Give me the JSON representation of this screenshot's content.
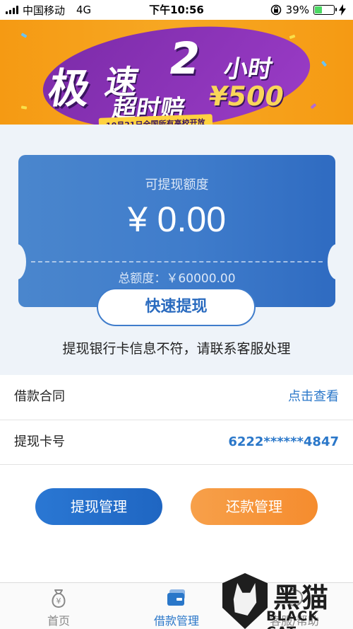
{
  "status_bar": {
    "carrier": "中国移动",
    "network": "4G",
    "time": "下午10:56",
    "battery_text": "39%",
    "battery_level": 0.39
  },
  "banner": {
    "word1": "极",
    "word2": "速",
    "number": "2",
    "unit": "小时",
    "overtime": "超时赔",
    "amount": "¥500",
    "tagline": "10月21日全国所有高校开放"
  },
  "card": {
    "available_label": "可提现额度",
    "available_value": "¥ 0.00",
    "total_text": "总额度：￥60000.00",
    "quick_button": "快速提现"
  },
  "notice": "提现银行卡信息不符，请联系客服处理",
  "rows": [
    {
      "label": "借款合同",
      "value": "点击查看"
    },
    {
      "label": "提现卡号",
      "value": "6222******4847"
    }
  ],
  "actions": {
    "withdraw_manage": "提现管理",
    "repay_manage": "还款管理"
  },
  "tabbar": {
    "items": [
      {
        "label": "首页",
        "icon": "money-bag-icon"
      },
      {
        "label": "借款管理",
        "icon": "cards-icon"
      },
      {
        "label": "客服/帮助",
        "icon": "help-icon"
      }
    ],
    "active_index": 1
  },
  "watermark": {
    "cn": "黑猫",
    "en": "BLACK CAT"
  },
  "colors": {
    "primary": "#2a77c9",
    "orange": "#f58c2e",
    "ticket": "#3f7ccb"
  }
}
